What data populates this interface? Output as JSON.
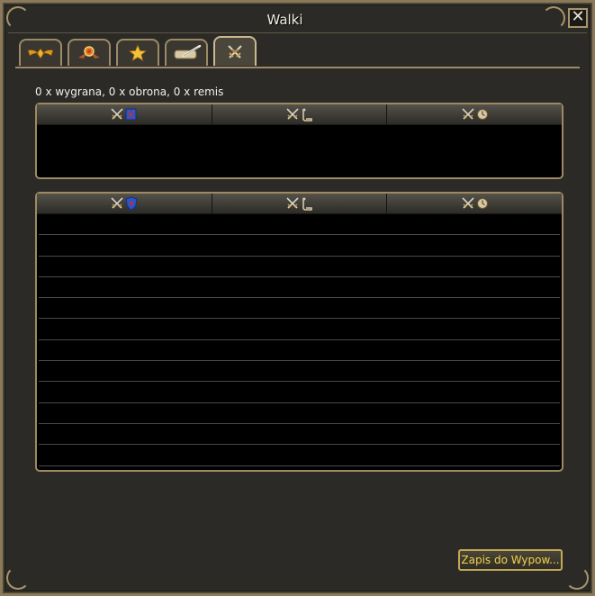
{
  "window": {
    "title": "Walki",
    "close_glyph": "✕"
  },
  "tabs": [
    {
      "icon": "winged-emblem-icon",
      "active": false
    },
    {
      "icon": "medal-icon",
      "active": false
    },
    {
      "icon": "star-icon",
      "active": false
    },
    {
      "icon": "scroll-quill-icon",
      "active": false
    },
    {
      "icon": "crossed-swords-icon",
      "active": true
    }
  ],
  "summary": "0 x wygrana, 0 x obrona, 0 x remis",
  "top_table": {
    "columns": [
      {
        "icons": [
          "crossed-swords-icon",
          "guild-flag-icon"
        ]
      },
      {
        "icons": [
          "crossed-swords-icon",
          "scroll-icon"
        ]
      },
      {
        "icons": [
          "crossed-swords-icon",
          "clock-icon"
        ]
      }
    ],
    "rows": []
  },
  "bottom_table": {
    "columns": [
      {
        "icons": [
          "crossed-swords-icon",
          "shield-icon"
        ]
      },
      {
        "icons": [
          "crossed-swords-icon",
          "scroll-icon"
        ]
      },
      {
        "icons": [
          "crossed-swords-icon",
          "clock-icon"
        ]
      }
    ],
    "row_count": 12
  },
  "save_button": {
    "label": "Zapis do Wypow..."
  },
  "colors": {
    "frame_gold": "#9d8a63",
    "button_text": "#f4d04a",
    "panel_bg": "#000000",
    "window_bg": "#2b2a26"
  }
}
